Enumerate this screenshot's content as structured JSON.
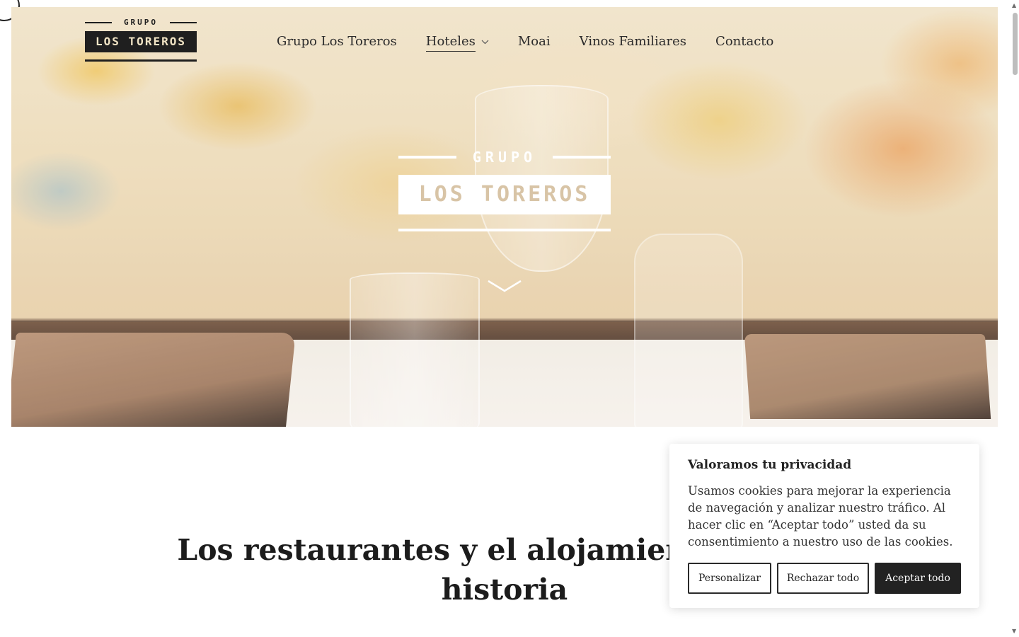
{
  "header": {
    "logo": {
      "top": "GRUPO",
      "main": "LOS TOREROS"
    },
    "nav": [
      {
        "label": "Grupo Los Toreros"
      },
      {
        "label": "Hoteles"
      },
      {
        "label": "Moai"
      },
      {
        "label": "Vinos Familiares"
      },
      {
        "label": "Contacto"
      }
    ],
    "active_nav": "Hoteles"
  },
  "hero": {
    "logo": {
      "top": "GRUPO",
      "main": "LOS TOREROS"
    }
  },
  "main": {
    "headline": "Los restaurantes y el alojamiento en Tor",
    "headline_line2": "historia"
  },
  "cookie_banner": {
    "title": "Valoramos tu privacidad",
    "body": "Usamos cookies para mejorar la experiencia de navegación y analizar nuestro tráfico. Al hacer clic en “Aceptar todo” usted da su consentimiento a nuestro uso de las cookies.",
    "buttons": {
      "customize": "Personalizar",
      "reject": "Rechazar todo",
      "accept": "Aceptar todo"
    }
  },
  "colors": {
    "dark": "#222222",
    "logo_text": "#f1e4c5",
    "hero_logo_text": "#d8c4a6"
  }
}
